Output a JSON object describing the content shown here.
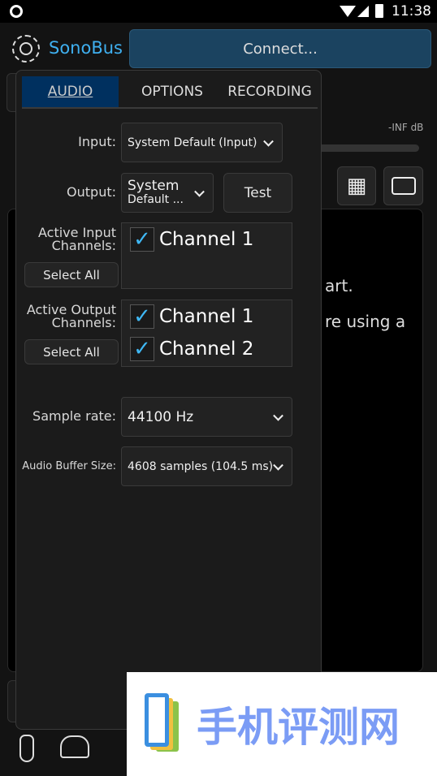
{
  "status_bar": {
    "time": "11:38"
  },
  "header": {
    "app_name": "SonoBus",
    "connect_label": "Connect..."
  },
  "background": {
    "level_label": "-INF dB",
    "hint_line1": "art.",
    "hint_line2": "re using a"
  },
  "popup": {
    "tabs": [
      {
        "label": "AUDIO",
        "active": true
      },
      {
        "label": "OPTIONS"
      },
      {
        "label": "RECORDING"
      }
    ],
    "input_label": "Input:",
    "input_value": "System Default (Input)",
    "output_label": "Output:",
    "output_value_line1": "System",
    "output_value_line2": "Default ...",
    "test_label": "Test",
    "active_input_label": "Active Input Channels:",
    "input_channels": [
      {
        "label": "Channel 1",
        "checked": true
      }
    ],
    "active_output_label": "Active Output Channels:",
    "output_channels": [
      {
        "label": "Channel 1",
        "checked": true
      },
      {
        "label": "Channel 2",
        "checked": true
      }
    ],
    "select_all_label": "Select All",
    "sample_rate_label": "Sample rate:",
    "sample_rate_value": "44100 Hz",
    "buffer_label": "Audio Buffer Size:",
    "buffer_value": "4608 samples (104.5 ms)"
  },
  "watermark": {
    "text": "手机评测网"
  },
  "colors": {
    "accent": "#3fb8f5",
    "connect_bg": "#1b4360",
    "tab_active": "#00305f"
  }
}
